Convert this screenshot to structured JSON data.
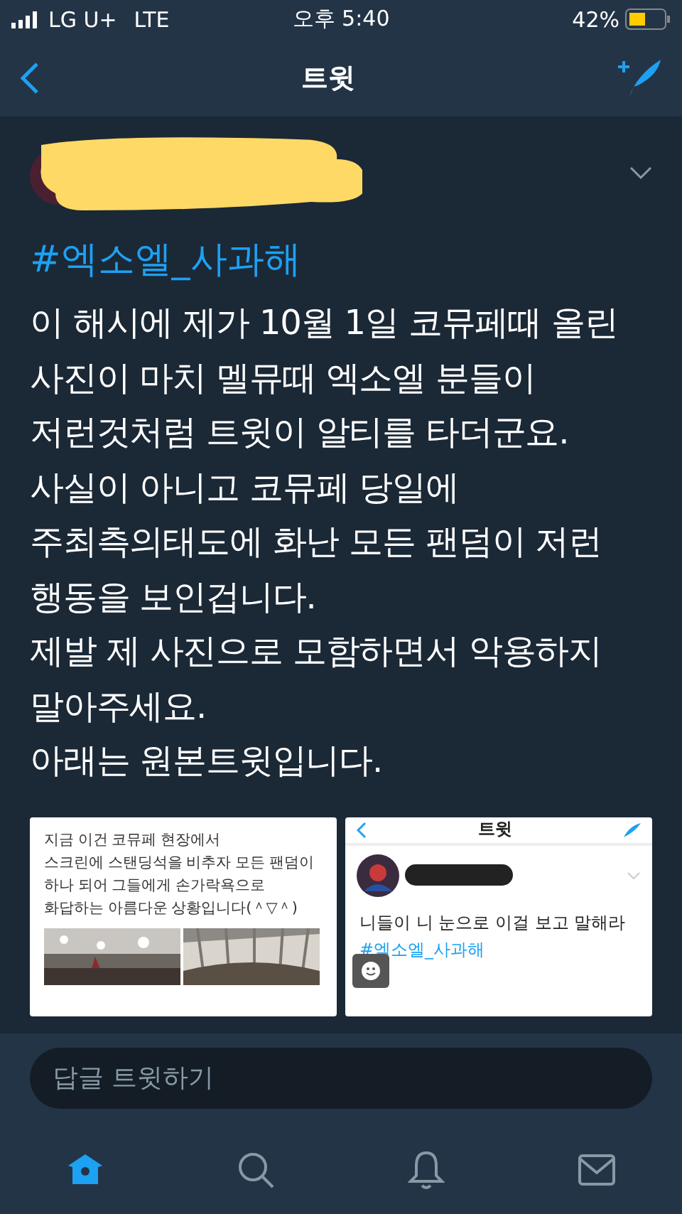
{
  "status_bar": {
    "carrier": "LG U+",
    "network": "LTE",
    "time": "오후 5:40",
    "battery": "42%"
  },
  "nav": {
    "title": "트윗"
  },
  "tweet": {
    "hashtag": "#엑소엘_사과해",
    "text": "이 해시에 제가 10월 1일 코뮤페때 올린\n사진이 마치 멜뮤때 엑소엘 분들이\n저런것처럼 트윗이 알티를 타더군요.\n사실이 아니고 코뮤페 당일에\n주최측의태도에 화난 모든 팬덤이 저런\n행동을 보인겁니다.\n제발 제 사진으로 모함하면서 악용하지\n말아주세요.\n아래는 원본트윗입니다.",
    "media": [
      {
        "kind": "post",
        "text": "지금 이건 코뮤페 현장에서\n스크린에 스탠딩석을 비추자 모든 팬덤이\n하나 되어 그들에게 손가락욕으로\n화답하는 아름다운 상황입니다(＾▽＾)"
      },
      {
        "kind": "screenshot",
        "title": "트윗",
        "text": "니들이 니 눈으로 이걸 보고 말해라",
        "hashtag": "#엑소엘_사과해"
      }
    ]
  },
  "reply": {
    "placeholder": "답글 트윗하기"
  },
  "tabs": [
    {
      "kind": "home",
      "selected": true
    },
    {
      "kind": "search",
      "selected": false
    },
    {
      "kind": "notifications",
      "selected": false
    },
    {
      "kind": "messages",
      "selected": false
    }
  ]
}
